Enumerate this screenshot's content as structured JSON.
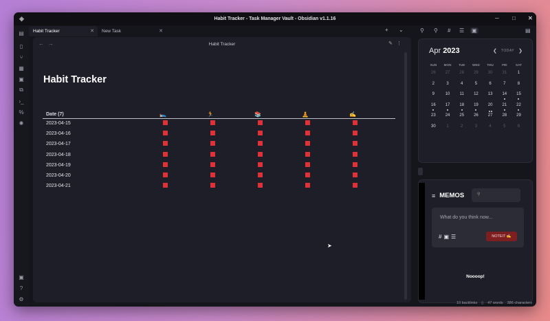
{
  "window": {
    "title": "Habit Tracker - Task Manager Vault - Obsidian v1.1.16"
  },
  "tabs": [
    {
      "label": "Habit Tracker",
      "active": true
    },
    {
      "label": "New Task",
      "active": false
    }
  ],
  "view": {
    "header_title": "Habit Tracker"
  },
  "document": {
    "title": "Habit Tracker",
    "table": {
      "date_header": "Date (7)",
      "habit_icons": [
        "🛌",
        "🏃",
        "📚",
        "🧘",
        "✍"
      ],
      "rows": [
        {
          "date": "2023-04-15",
          "status": [
            false,
            false,
            false,
            false,
            false
          ]
        },
        {
          "date": "2023-04-16",
          "status": [
            false,
            false,
            false,
            false,
            false
          ]
        },
        {
          "date": "2023-04-17",
          "status": [
            false,
            false,
            false,
            false,
            false
          ]
        },
        {
          "date": "2023-04-18",
          "status": [
            false,
            false,
            false,
            false,
            false
          ]
        },
        {
          "date": "2023-04-19",
          "status": [
            false,
            false,
            false,
            false,
            false
          ]
        },
        {
          "date": "2023-04-20",
          "status": [
            false,
            false,
            false,
            false,
            false
          ]
        },
        {
          "date": "2023-04-21",
          "status": [
            false,
            false,
            false,
            false,
            false
          ]
        }
      ]
    }
  },
  "calendar": {
    "month": "Apr",
    "year": "2023",
    "today_label": "TODAY",
    "weekdays": [
      "SUN",
      "MON",
      "TUE",
      "WED",
      "THU",
      "FRI",
      "SAT"
    ],
    "weeks": [
      [
        {
          "d": "26",
          "dim": true
        },
        {
          "d": "27",
          "dim": true
        },
        {
          "d": "28",
          "dim": true
        },
        {
          "d": "29",
          "dim": true
        },
        {
          "d": "30",
          "dim": true
        },
        {
          "d": "31",
          "dim": true
        },
        {
          "d": "1"
        }
      ],
      [
        {
          "d": "2"
        },
        {
          "d": "3"
        },
        {
          "d": "4"
        },
        {
          "d": "5"
        },
        {
          "d": "6"
        },
        {
          "d": "7"
        },
        {
          "d": "8"
        }
      ],
      [
        {
          "d": "9"
        },
        {
          "d": "10"
        },
        {
          "d": "11"
        },
        {
          "d": "12"
        },
        {
          "d": "13"
        },
        {
          "d": "14",
          "dots": 1
        },
        {
          "d": "15",
          "dots": 1
        }
      ],
      [
        {
          "d": "16",
          "dots": 1
        },
        {
          "d": "17",
          "dots": 1
        },
        {
          "d": "18",
          "dots": 1
        },
        {
          "d": "19",
          "dots": 1
        },
        {
          "d": "20",
          "dots": 2
        },
        {
          "d": "21",
          "dots": 1
        },
        {
          "d": "22",
          "dots": 1
        }
      ],
      [
        {
          "d": "23"
        },
        {
          "d": "24"
        },
        {
          "d": "25"
        },
        {
          "d": "26"
        },
        {
          "d": "27"
        },
        {
          "d": "28"
        },
        {
          "d": "29"
        }
      ],
      [
        {
          "d": "30"
        },
        {
          "d": "1",
          "dim": true
        },
        {
          "d": "2",
          "dim": true
        },
        {
          "d": "3",
          "dim": true
        },
        {
          "d": "4",
          "dim": true
        },
        {
          "d": "5",
          "dim": true
        },
        {
          "d": "6",
          "dim": true
        }
      ]
    ]
  },
  "memos": {
    "title": "MEMOS",
    "placeholder": "What do you think now...",
    "send_label": "NOTEIT ✍",
    "empty_text": "Noooop!"
  },
  "status_bar": {
    "backlinks": "10 backlinks",
    "words": "47 words",
    "characters": "386 characters"
  },
  "colors": {
    "accent_red": "#e03137",
    "window_bg": "#15151c",
    "pane_bg": "#1e1e28"
  }
}
